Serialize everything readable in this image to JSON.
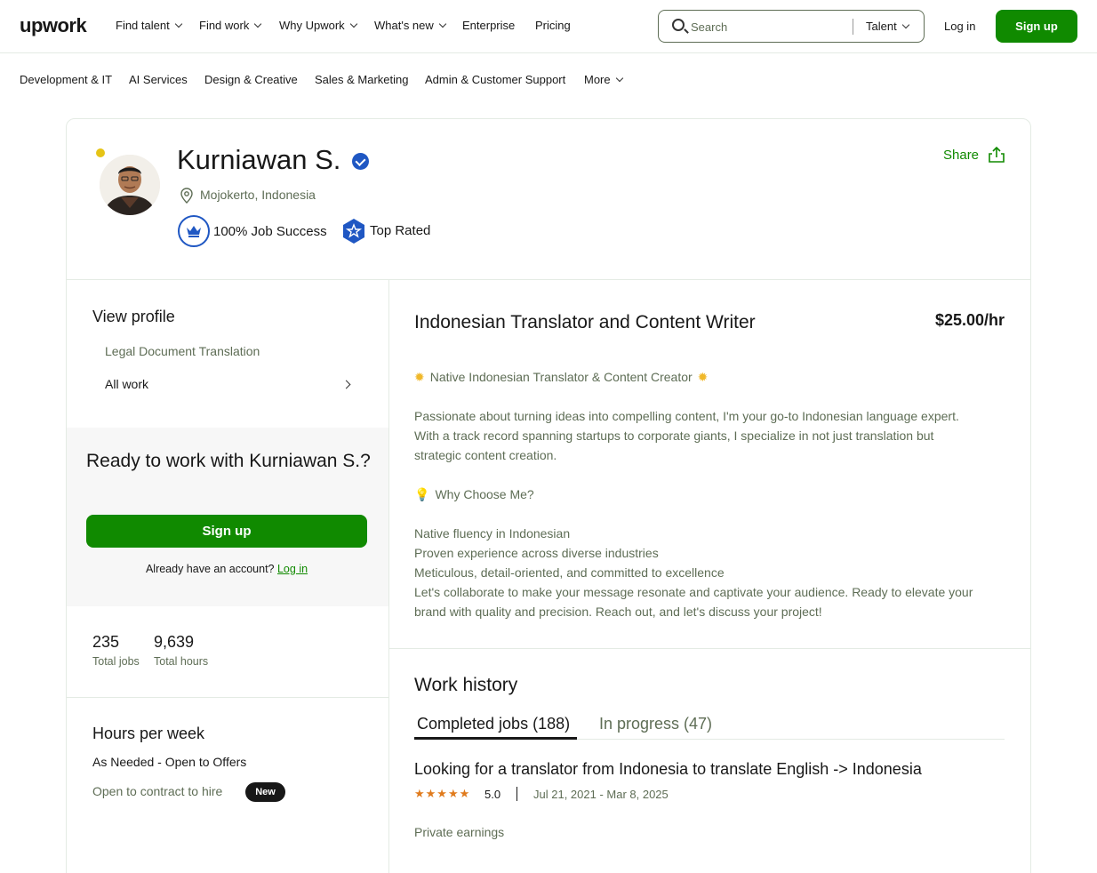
{
  "topnav": {
    "logo": "upwork",
    "items": [
      "Find talent",
      "Find work",
      "Why Upwork",
      "What's new",
      "Enterprise",
      "Pricing"
    ],
    "search_placeholder": "Search",
    "search_scope": "Talent",
    "login": "Log in",
    "signup": "Sign up"
  },
  "categories": [
    "Development & IT",
    "AI Services",
    "Design & Creative",
    "Sales & Marketing",
    "Admin & Customer Support",
    "More"
  ],
  "profile": {
    "name": "Kurniawan S.",
    "location": "Mojokerto, Indonesia",
    "job_success": "100% Job Success",
    "badge": "Top Rated",
    "share": "Share"
  },
  "sidebar": {
    "view_profile_title": "View profile",
    "items": [
      "Legal Document Translation",
      "All work"
    ],
    "ready_title": "Ready to work with Kurniawan S.?",
    "signup": "Sign up",
    "already_text": "Already have an account?",
    "login": "Log in",
    "stats": [
      {
        "value": "235",
        "label": "Total jobs"
      },
      {
        "value": "9,639",
        "label": "Total hours"
      }
    ],
    "hours_title": "Hours per week",
    "hours_value": "As Needed - Open to Offers",
    "contract_text": "Open to contract to hire",
    "new_badge": "New"
  },
  "main": {
    "headline": "Indonesian Translator and Content Writer",
    "rate": "$25.00/hr",
    "tagline": "Native Indonesian Translator & Content Creator",
    "para1_line1": "Passionate about turning ideas into compelling content, I'm your go-to Indonesian language expert.",
    "para1_line2": "With a track record spanning startups to corporate giants, I specialize in not just translation but",
    "para1_line3": "strategic content creation.",
    "why_title": "Why Choose Me?",
    "points": [
      "Native fluency in Indonesian",
      "Proven experience across diverse industries",
      "Meticulous, detail-oriented, and committed to excellence",
      "Let's collaborate to make your message resonate and captivate your audience. Ready to elevate your",
      "brand with quality and precision. Reach out, and let's discuss your project!"
    ]
  },
  "work_history": {
    "title": "Work history",
    "tab_completed": "Completed jobs (188)",
    "tab_progress": "In progress (47)",
    "job": {
      "title": "Looking for a translator from Indonesia to translate English -> Indonesia",
      "stars": "★★★★★",
      "rating": "5.0",
      "dates": "Jul 21, 2021 - Mar 8, 2025",
      "earnings": "Private earnings"
    }
  },
  "colors": {
    "brand_green": "#108a00",
    "verified_blue": "#1f57c3",
    "star_orange": "#e07b1d",
    "online_yellow": "#e6c416"
  }
}
